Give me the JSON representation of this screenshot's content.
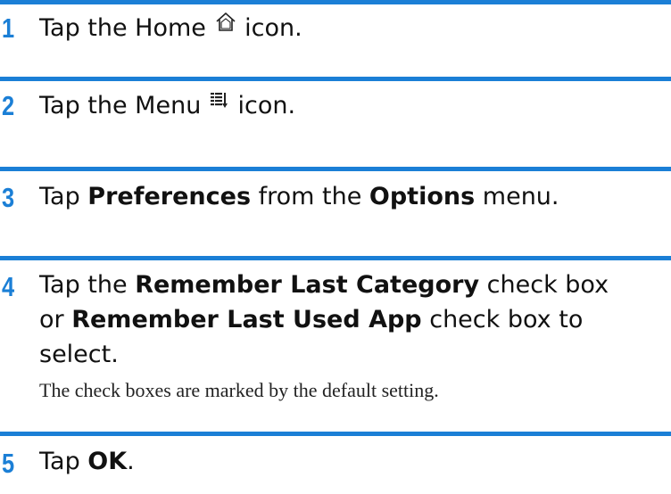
{
  "accent_color": "#1b7fd6",
  "steps": [
    {
      "number": "1",
      "before": "Tap the Home",
      "icon": "home-icon",
      "after": "icon."
    },
    {
      "number": "2",
      "before": "Tap the Menu",
      "icon": "menu-icon",
      "after": "icon."
    },
    {
      "number": "3",
      "t1": "Tap ",
      "b1": "Preferences",
      "t2": " from the ",
      "b2": "Options",
      "t3": " menu."
    },
    {
      "number": "4",
      "t1": "Tap the ",
      "b1": "Remember Last Category",
      "t2": " check box",
      "t3": "or ",
      "b2": "Remember Last Used App",
      "t4": " check box to",
      "t5": "select.",
      "note": "The check boxes are marked by the default setting."
    },
    {
      "number": "5",
      "t1": "Tap ",
      "b1": "OK",
      "t2": "."
    }
  ]
}
